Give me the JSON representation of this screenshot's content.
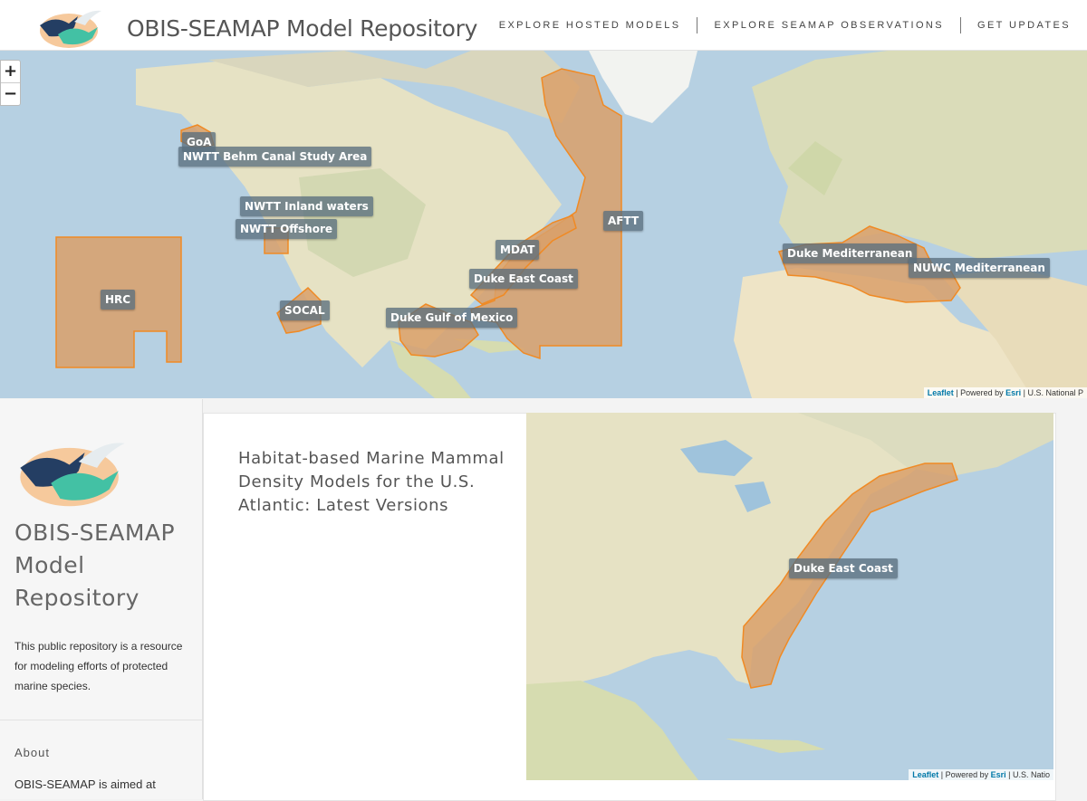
{
  "header": {
    "title": "OBIS-SEAMAP Model Repository",
    "nav": [
      {
        "label": "EXPLORE HOSTED MODELS"
      },
      {
        "label": "EXPLORE SEAMAP OBSERVATIONS"
      },
      {
        "label": "GET UPDATES"
      }
    ]
  },
  "main_map": {
    "zoom_in": "+",
    "zoom_out": "−",
    "labels": {
      "goa": "GoA",
      "behm": "NWTT Behm Canal Study Area",
      "inland": "NWTT Inland waters",
      "offshore": "NWTT Offshore",
      "hrc": "HRC",
      "socal": "SOCAL",
      "mdat": "MDAT",
      "duke_east": "Duke East Coast",
      "duke_gulf": "Duke Gulf of Mexico",
      "aftt": "AFTT",
      "duke_med": "Duke Mediterranean",
      "nuwc_med": "NUWC Mediterranean"
    },
    "attribution": {
      "leaflet": "Leaflet",
      "powered": " | Powered by ",
      "esri": "Esri",
      "rest": " | U.S. National P"
    }
  },
  "sidebar": {
    "title": "OBIS-SEAMAP Model Repository",
    "description": "This public repository is a resource for modeling efforts of protected marine species.",
    "about_heading": "About",
    "about_text": "OBIS-SEAMAP is aimed at"
  },
  "content": {
    "title": "Habitat-based Marine Mammal Density Models for the U.S. Atlantic: Latest Versions",
    "map": {
      "label": "Duke East Coast",
      "attribution": {
        "leaflet": "Leaflet",
        "powered": " | Powered by ",
        "esri": "Esri",
        "rest": " | U.S. Natio"
      }
    }
  },
  "colors": {
    "region_fill": "#d9a06a",
    "region_stroke": "#f08a24",
    "ocean": "#b9d3e3",
    "land": "#e9e4c8"
  }
}
